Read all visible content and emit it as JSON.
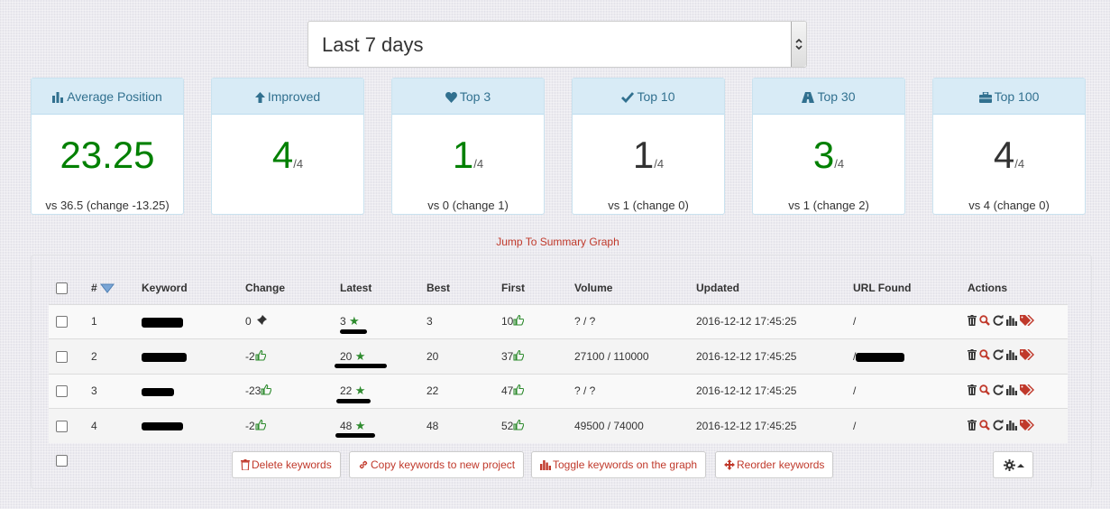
{
  "period": {
    "selected": "Last 7 days"
  },
  "cards": [
    {
      "title": "Average Position",
      "icon": "bar-chart-icon",
      "value": "23.25",
      "total": "",
      "vs": "vs 36.5 (change -13.25)",
      "value_color": "#008000"
    },
    {
      "title": "Improved",
      "icon": "arrow-up-icon",
      "value": "4",
      "total": "/4",
      "vs": "",
      "value_color": "#008000"
    },
    {
      "title": "Top 3",
      "icon": "heart-icon",
      "value": "1",
      "total": "/4",
      "vs": "vs 0 (change 1)",
      "value_color": "#008000"
    },
    {
      "title": "Top 10",
      "icon": "check-icon",
      "value": "1",
      "total": "/4",
      "vs": "vs 1 (change 0)",
      "value_color": "#333333"
    },
    {
      "title": "Top 30",
      "icon": "road-icon",
      "value": "3",
      "total": "/4",
      "vs": "vs 1 (change 2)",
      "value_color": "#008000"
    },
    {
      "title": "Top 100",
      "icon": "briefcase-icon",
      "value": "4",
      "total": "/4",
      "vs": "vs 4 (change 0)",
      "value_color": "#333333"
    }
  ],
  "jump_link": "Jump To Summary Graph",
  "table": {
    "headers": {
      "num": "#",
      "keyword": "Keyword",
      "change": "Change",
      "latest": "Latest",
      "best": "Best",
      "first": "First",
      "volume": "Volume",
      "updated": "Updated",
      "url": "URL Found",
      "actions": "Actions"
    },
    "rows": [
      {
        "num": "1",
        "change": "0",
        "latest": "3",
        "best": "3",
        "first": "10",
        "volume": "? / ?",
        "updated": "2016-12-12 17:45:25",
        "url": "/"
      },
      {
        "num": "2",
        "change": "-2",
        "latest": "20",
        "best": "20",
        "first": "37",
        "volume": "27100 / 110000",
        "updated": "2016-12-12 17:45:25",
        "url": "/"
      },
      {
        "num": "3",
        "change": "-23",
        "latest": "22",
        "best": "22",
        "first": "47",
        "volume": "? / ?",
        "updated": "2016-12-12 17:45:25",
        "url": "/"
      },
      {
        "num": "4",
        "change": "-2",
        "latest": "48",
        "best": "48",
        "first": "52",
        "volume": "49500 / 74000",
        "updated": "2016-12-12 17:45:25",
        "url": "/"
      }
    ]
  },
  "buttons": {
    "delete": "Delete keywords",
    "copy": "Copy keywords to new project",
    "toggle": "Toggle keywords on the graph",
    "reorder": "Reorder keywords"
  },
  "colors": {
    "accent_red": "#c0392b",
    "card_header": "#d8ebf6",
    "green": "#008000"
  }
}
